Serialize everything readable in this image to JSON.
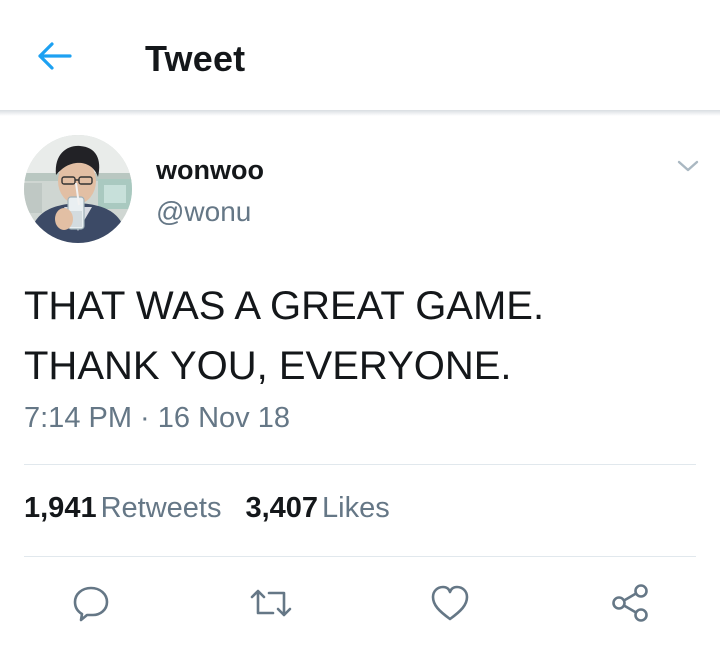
{
  "header": {
    "title": "Tweet",
    "back_icon": "back-arrow-icon",
    "accent_color": "#1da1f2"
  },
  "tweet": {
    "display_name": "wonwoo",
    "handle": "@wonu",
    "text": "THAT WAS A GREAT GAME.\nTHANK YOU, EVERYONE.",
    "timestamp": "7:14 PM · 16 Nov 18",
    "avatar_icon": "profile-photo",
    "menu_icon": "chevron-down-icon"
  },
  "stats": {
    "retweets_count": "1,941",
    "retweets_label": "Retweets",
    "likes_count": "3,407",
    "likes_label": "Likes"
  },
  "actions": {
    "reply_icon": "reply-icon",
    "retweet_icon": "retweet-icon",
    "like_icon": "heart-icon",
    "share_icon": "share-icon",
    "icon_color": "#657786"
  },
  "colors": {
    "primary_text": "#14171a",
    "secondary_text": "#657786",
    "divider": "#e1e8ed"
  }
}
